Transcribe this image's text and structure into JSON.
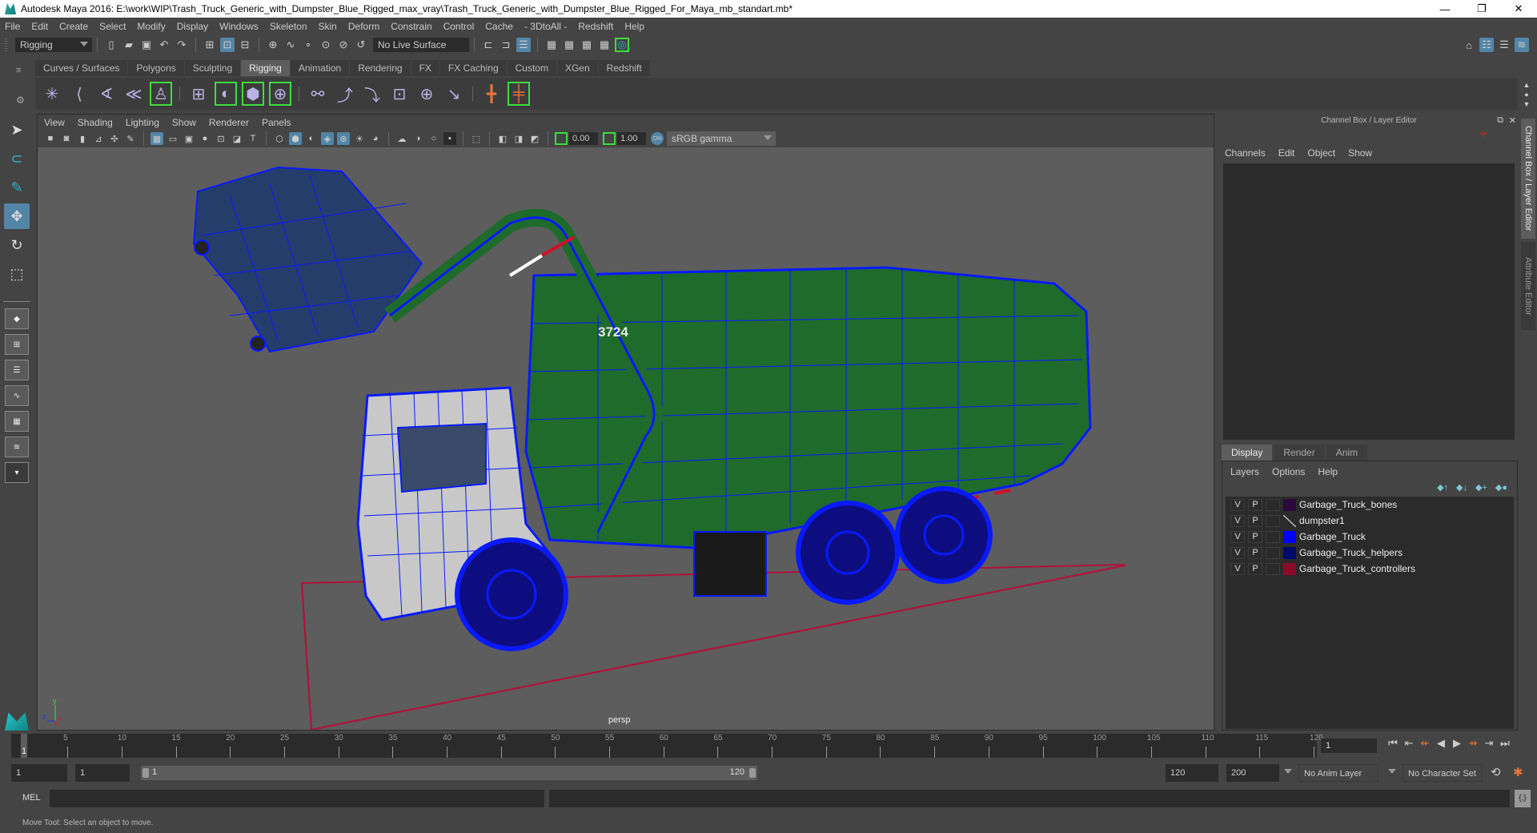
{
  "window": {
    "title": "Autodesk Maya 2016: E:\\work\\WIP\\Trash_Truck_Generic_with_Dumpster_Blue_Rigged_max_vray\\Trash_Truck_Generic_with_Dumpster_Blue_Rigged_For_Maya_mb_standart.mb*",
    "controls": {
      "minimize": "—",
      "maximize": "❐",
      "close": "✕"
    }
  },
  "menubar": [
    "File",
    "Edit",
    "Create",
    "Select",
    "Modify",
    "Display",
    "Windows",
    "Skeleton",
    "Skin",
    "Deform",
    "Constrain",
    "Control",
    "Cache",
    "- 3DtoAll -",
    "Redshift",
    "Help"
  ],
  "statusline": {
    "menuset": "Rigging",
    "live_surface": "No Live Surface"
  },
  "shelf": {
    "tabs": [
      "Curves / Surfaces",
      "Polygons",
      "Sculpting",
      "Rigging",
      "Animation",
      "Rendering",
      "FX",
      "FX Caching",
      "Custom",
      "XGen",
      "Redshift"
    ],
    "active_tab": "Rigging",
    "icons": [
      "joint-tool",
      "ik-handle",
      "ik-spline",
      "ik-spring",
      "humanik",
      "bind-skin",
      "smooth-bind",
      "lattice",
      "cluster",
      "parent-constraint",
      "point-constraint",
      "orient-constraint",
      "scale-constraint",
      "aim-constraint",
      "pole-vector",
      "locator-red",
      "constraint-red"
    ]
  },
  "toolbox": {
    "tools": [
      "select-tool",
      "lasso-tool",
      "paint-select-tool",
      "move-tool",
      "rotate-tool",
      "scale-tool"
    ],
    "active_tool": "move-tool"
  },
  "viewport": {
    "menu": [
      "View",
      "Shading",
      "Lighting",
      "Show",
      "Renderer",
      "Panels"
    ],
    "exposure": "0.00",
    "gamma": "1.00",
    "color_space": "sRGB gamma",
    "camera_label": "persp",
    "truck_number": "3724",
    "axis_labels": {
      "y": "y",
      "z": "z",
      "x": "x"
    }
  },
  "channel_box": {
    "title": "Channel Box / Layer Editor",
    "menu": [
      "Channels",
      "Edit",
      "Object",
      "Show"
    ]
  },
  "layer_editor": {
    "tabs": [
      "Display",
      "Render",
      "Anim"
    ],
    "active_tab": "Display",
    "menu": [
      "Layers",
      "Options",
      "Help"
    ],
    "layers": [
      {
        "v": "V",
        "p": "P",
        "color": "#2a0a3a",
        "name": "Garbage_Truck_bones"
      },
      {
        "v": "V",
        "p": "P",
        "color": "none",
        "name": "dumpster1"
      },
      {
        "v": "V",
        "p": "P",
        "color": "#0000ff",
        "name": "Garbage_Truck"
      },
      {
        "v": "V",
        "p": "P",
        "color": "#000a6a",
        "name": "Garbage_Truck_helpers"
      },
      {
        "v": "V",
        "p": "P",
        "color": "#8a0a2a",
        "name": "Garbage_Truck_controllers"
      }
    ]
  },
  "side_tabs": [
    "Channel Box / Layer Editor",
    "Attribute Editor"
  ],
  "timeline": {
    "ticks": [
      5,
      10,
      15,
      20,
      25,
      30,
      35,
      40,
      45,
      50,
      55,
      60,
      65,
      70,
      75,
      80,
      85,
      90,
      95,
      100,
      105,
      110,
      115,
      120
    ],
    "start": 1,
    "end": 120,
    "current_frame": "1",
    "current_marker": "1"
  },
  "range": {
    "start_time": "1",
    "playback_start": "1",
    "slider_start": "1",
    "slider_end": "120",
    "playback_end": "120",
    "end_time": "200",
    "anim_layer": "No Anim Layer",
    "character_set": "No Character Set"
  },
  "command_line": {
    "label": "MEL",
    "value": ""
  },
  "help_line": "Move Tool: Select an object to move.",
  "colors": {
    "accent": "#5285a6",
    "highlight_green": "#3fdc3f",
    "wire_blue": "#0a1aff",
    "truck_green": "#1e6b2c",
    "ground_red": "#b0123a"
  }
}
